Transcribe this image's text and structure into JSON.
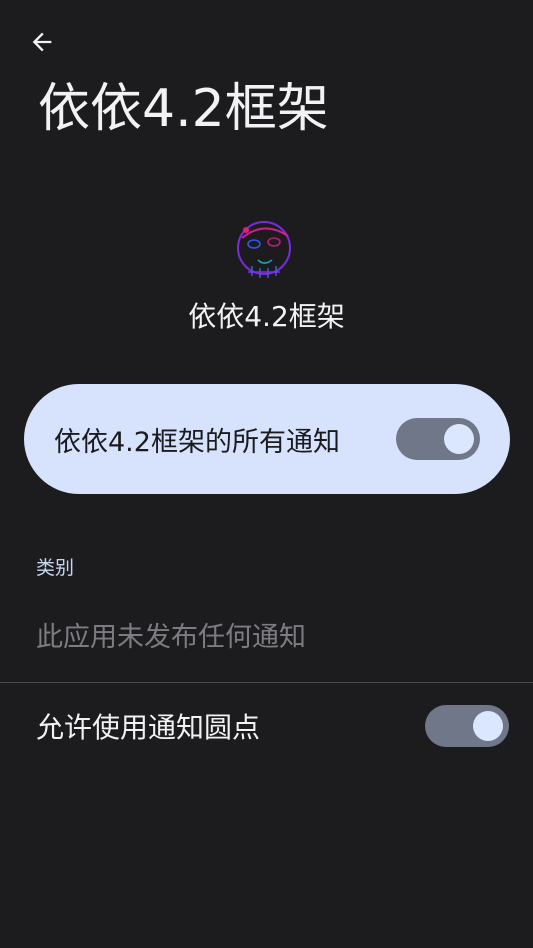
{
  "header": {
    "back_icon": "arrow-left-icon",
    "title": "依依4.2框架"
  },
  "app": {
    "icon": "app-avatar-icon",
    "name": "依依4.2框架"
  },
  "all_notifications": {
    "label": "依依4.2框架的所有通知",
    "enabled": true
  },
  "categories": {
    "header": "类别",
    "empty_message": "此应用未发布任何通知"
  },
  "notification_dot": {
    "label": "允许使用通知圆点",
    "enabled": true
  },
  "colors": {
    "background": "#1c1c1e",
    "card": "#d7e3fc",
    "switch_track": "#6f7788",
    "switch_knob": "#dbe6ff",
    "accent_text": "#c9d6f2"
  }
}
